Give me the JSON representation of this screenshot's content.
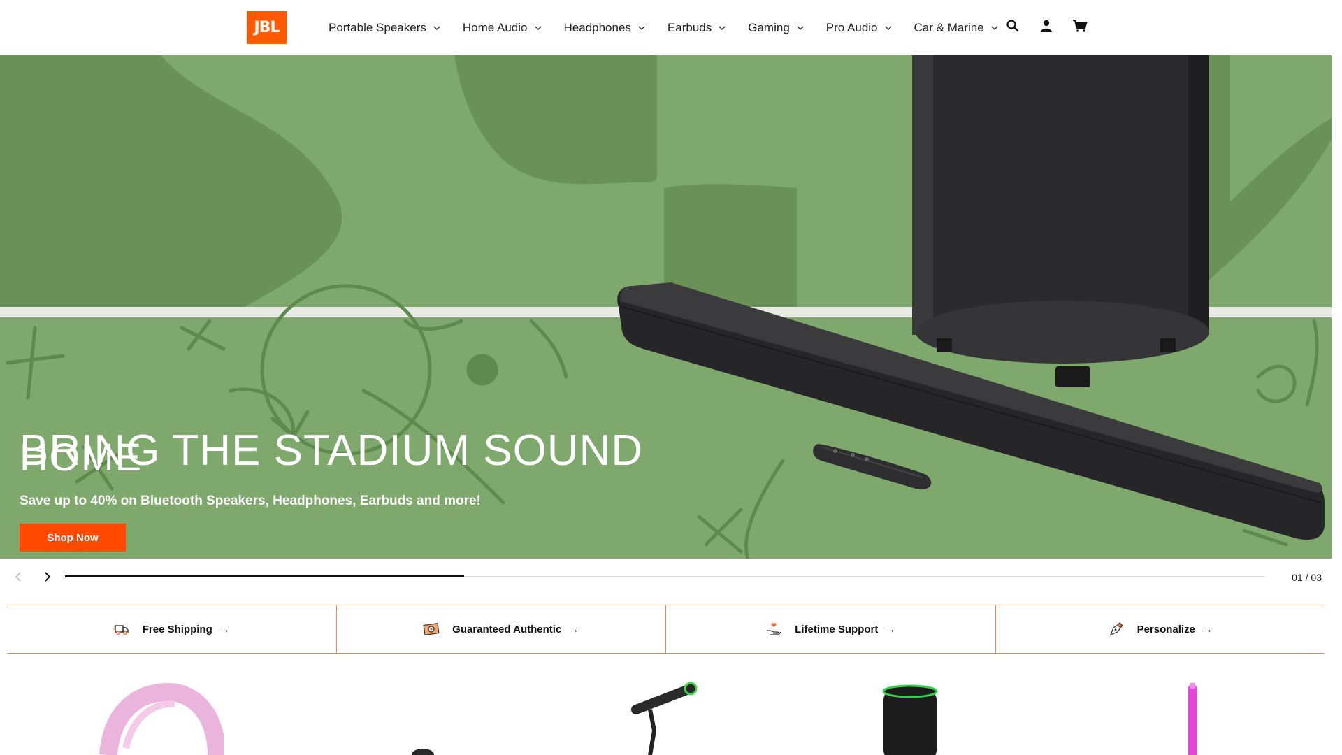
{
  "brand": {
    "logo_text": "JBL",
    "color": "#ff5a00"
  },
  "nav": {
    "items": [
      {
        "label": "Portable Speakers"
      },
      {
        "label": "Home Audio"
      },
      {
        "label": "Headphones"
      },
      {
        "label": "Earbuds"
      },
      {
        "label": "Gaming"
      },
      {
        "label": "Pro Audio"
      },
      {
        "label": "Car & Marine"
      }
    ],
    "icons": [
      "search-icon",
      "account-icon",
      "cart-icon"
    ]
  },
  "hero": {
    "title_line1": "BRING THE STADIUM SOUND",
    "title_line2": "HOME",
    "subtitle": "Save up to 40% on Bluetooth Speakers, Headphones, Earbuds and more!",
    "cta_label": "Shop Now",
    "bg_color": "#7fa86c",
    "cta_color": "#ff4a00"
  },
  "slider": {
    "counter": "01 / 03",
    "progress_fraction": 0.333
  },
  "benefits": [
    {
      "label": "Free Shipping",
      "arrow": "→",
      "icon": "truck-icon"
    },
    {
      "label": "Guaranteed Authentic",
      "arrow": "→",
      "icon": "certificate-icon"
    },
    {
      "label": "Lifetime Support",
      "arrow": "→",
      "icon": "support-hand-icon"
    },
    {
      "label": "Personalize",
      "arrow": "→",
      "icon": "pen-icon"
    }
  ],
  "products": [
    "headphones-image",
    "earbuds-image",
    "microphone-image",
    "party-speaker-image",
    "light-stick-image"
  ]
}
